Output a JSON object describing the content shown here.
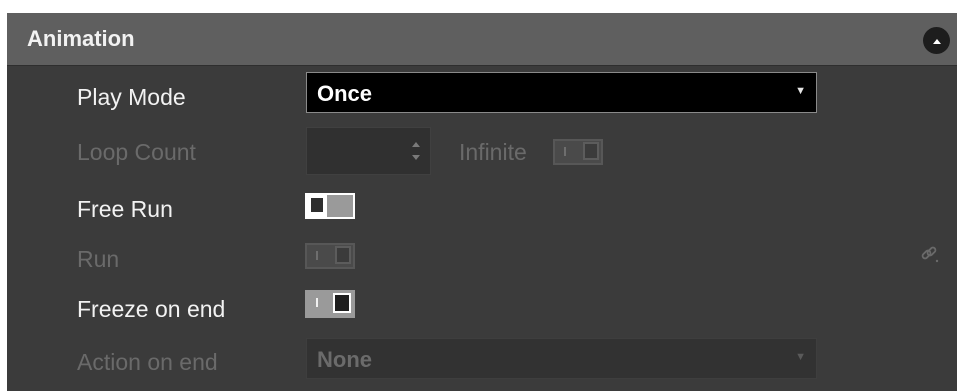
{
  "section": {
    "title": "Animation"
  },
  "play_mode": {
    "label": "Play Mode",
    "value": "Once"
  },
  "loop_count": {
    "label": "Loop Count",
    "value": "",
    "infinite_label": "Infinite"
  },
  "free_run": {
    "label": "Free Run",
    "state": "off"
  },
  "run": {
    "label": "Run",
    "state": "on",
    "enabled": false
  },
  "freeze_on_end": {
    "label": "Freeze on end",
    "state": "on"
  },
  "action_on_end": {
    "label": "Action on end",
    "value": "None"
  },
  "icons": {
    "collapse": "chevron-up-icon",
    "link": "link-icon",
    "dropdown": "caret-down-icon",
    "spinner": "spinner-arrows-icon"
  },
  "colors": {
    "panel_bg": "#3b3b3b",
    "header_bg": "#5f5f5f",
    "text_enabled": "#f2f2f2",
    "text_disabled": "#6a6a6a"
  }
}
